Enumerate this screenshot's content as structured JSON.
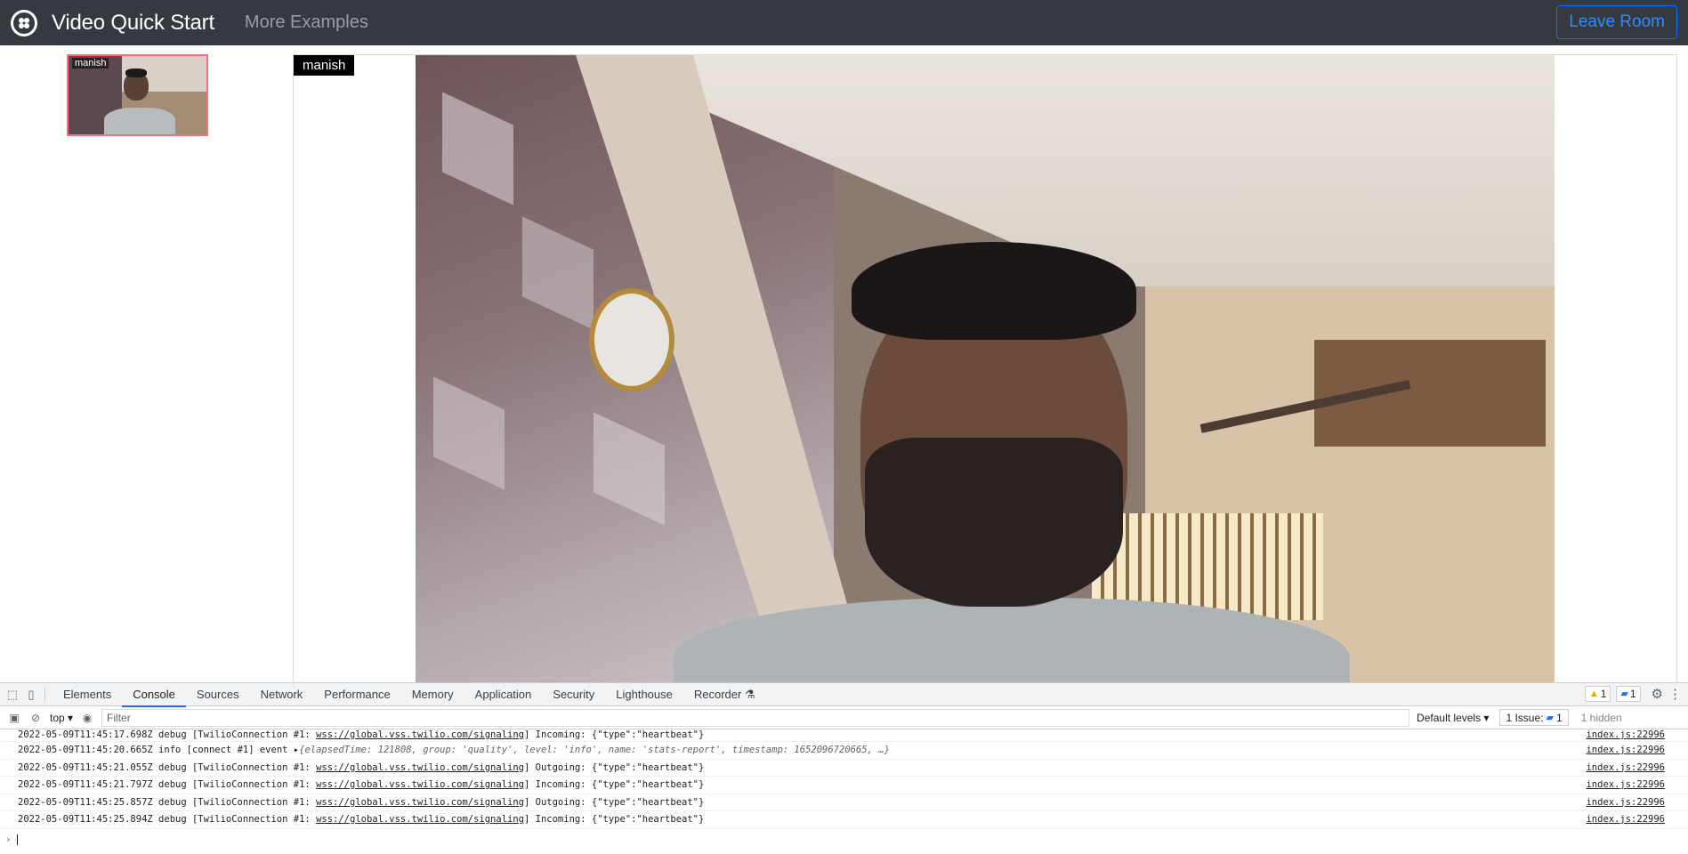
{
  "navbar": {
    "brand": "Video Quick Start",
    "more_examples": "More Examples",
    "leave_room": "Leave Room"
  },
  "participants": {
    "local_thumbnail_name": "manish",
    "main_name": "manish"
  },
  "devtools": {
    "tabs": [
      "Elements",
      "Console",
      "Sources",
      "Network",
      "Performance",
      "Memory",
      "Application",
      "Security",
      "Lighthouse",
      "Recorder"
    ],
    "active_tab": "Console",
    "warnings_count": "1",
    "messages_count": "1",
    "context": "top",
    "filter_placeholder": "Filter",
    "default_levels": "Default levels",
    "issues_label": "1 Issue:",
    "issues_count": "1",
    "hidden_label": "1 hidden",
    "logs": [
      {
        "ts": "2022-05-09T11:45:17.698Z",
        "level": "debug",
        "conn": "[TwilioConnection #1:",
        "url": "wss://global.vss.twilio.com/signaling",
        "dir": "Incoming:",
        "msg": "{\"type\":\"heartbeat\"}",
        "src": "index.js:22996"
      },
      {
        "ts": "2022-05-09T11:45:20.665Z",
        "level": "info",
        "conn": "[connect #1] event",
        "url": "",
        "dir": "",
        "msg": "{elapsedTime: 121808, group: 'quality', level: 'info', name: 'stats-report', timestamp: 1652096720665, …}",
        "src": "index.js:22996"
      },
      {
        "ts": "2022-05-09T11:45:21.055Z",
        "level": "debug",
        "conn": "[TwilioConnection #1:",
        "url": "wss://global.vss.twilio.com/signaling",
        "dir": "Outgoing:",
        "msg": "{\"type\":\"heartbeat\"}",
        "src": "index.js:22996"
      },
      {
        "ts": "2022-05-09T11:45:21.797Z",
        "level": "debug",
        "conn": "[TwilioConnection #1:",
        "url": "wss://global.vss.twilio.com/signaling",
        "dir": "Incoming:",
        "msg": "{\"type\":\"heartbeat\"}",
        "src": "index.js:22996"
      },
      {
        "ts": "2022-05-09T11:45:25.857Z",
        "level": "debug",
        "conn": "[TwilioConnection #1:",
        "url": "wss://global.vss.twilio.com/signaling",
        "dir": "Outgoing:",
        "msg": "{\"type\":\"heartbeat\"}",
        "src": "index.js:22996"
      },
      {
        "ts": "2022-05-09T11:45:25.894Z",
        "level": "debug",
        "conn": "[TwilioConnection #1:",
        "url": "wss://global.vss.twilio.com/signaling",
        "dir": "Incoming:",
        "msg": "{\"type\":\"heartbeat\"}",
        "src": "index.js:22996"
      }
    ],
    "prompt_symbol": "›"
  }
}
